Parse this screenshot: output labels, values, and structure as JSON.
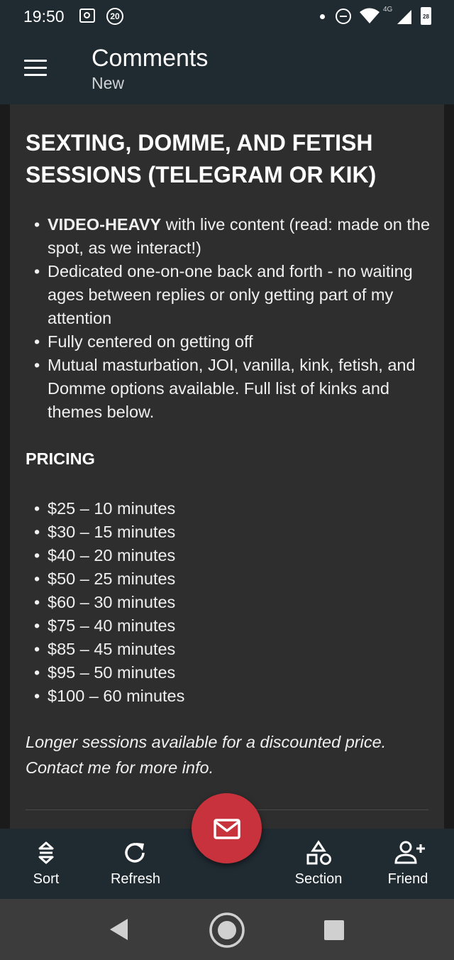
{
  "status_bar": {
    "time": "19:50",
    "notification_badge": "20",
    "network_type": "4G",
    "battery_level": "28",
    "icons": [
      "screenshot-icon",
      "notification-badge-icon",
      "dot-icon",
      "do-not-disturb-icon",
      "wifi-icon",
      "signal-icon",
      "battery-icon"
    ]
  },
  "app_bar": {
    "title": "Comments",
    "subtitle": "New",
    "menu_icon": "hamburger-menu-icon"
  },
  "post": {
    "heading": "SEXTING, DOMME, AND FETISH SESSIONS (TELEGRAM OR KIK)",
    "features": [
      {
        "bold": "VIDEO-HEAVY",
        "text": " with live content (read: made on the spot, as we interact!)"
      },
      {
        "bold": "",
        "text": "Dedicated one-on-one back and forth - no waiting ages between replies or only getting part of my attention"
      },
      {
        "bold": "",
        "text": "Fully centered on getting off"
      },
      {
        "bold": "",
        "text": "Mutual masturbation, JOI, vanilla, kink, fetish, and Domme options available. Full list of kinks and themes below."
      }
    ],
    "pricing_heading": "PRICING",
    "prices": [
      "$25 – 10 minutes",
      "$30 – 15 minutes",
      "$40 – 20 minutes",
      "$50 – 25 minutes",
      "$60 – 30 minutes",
      "$75 – 40 minutes",
      "$85 – 45 minutes",
      "$95 – 50 minutes",
      "$100 – 60 minutes"
    ],
    "note_line1": "Longer sessions available for a discounted price.",
    "note_line2": "Contact me for more info."
  },
  "toolbar": {
    "sort_label": "Sort",
    "refresh_label": "Refresh",
    "section_label": "Section",
    "friend_label": "Friend",
    "fab_icon": "mail-icon"
  },
  "colors": {
    "bar_background": "#1f2a31",
    "content_background": "#2e2e2e",
    "fab": "#c8323c",
    "system_nav": "#3c3c3c"
  }
}
